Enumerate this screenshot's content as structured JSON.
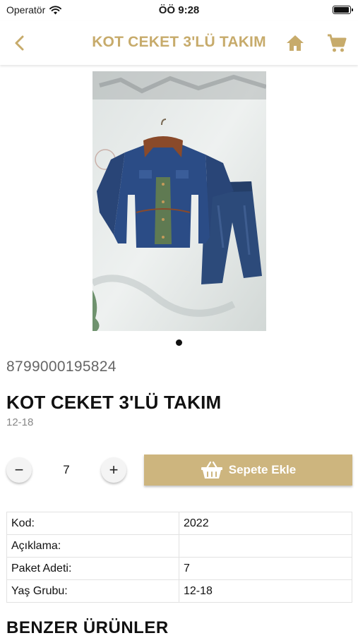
{
  "status_bar": {
    "carrier": "Operatör",
    "time": "ÖÖ 9:28",
    "battery_level": 0.95
  },
  "nav": {
    "title": "KOT CEKET 3'LÜ TAKIM",
    "back_icon": "chevron-left-icon",
    "home_icon": "home-icon",
    "cart_icon": "cart-icon",
    "accent_color": "#c7ab6b"
  },
  "product": {
    "barcode": "8799000195824",
    "title": "KOT CEKET 3'LÜ TAKIM",
    "subtitle": "12-18",
    "image_pages": 1,
    "current_image": 1
  },
  "quantity": {
    "minus_label": "−",
    "plus_label": "+",
    "value": "7"
  },
  "cart_button": {
    "label": "Sepete Ekle",
    "icon": "basket-icon",
    "color": "#cdb57e"
  },
  "specs": [
    {
      "key": "Kod:",
      "value": "2022"
    },
    {
      "key": "Açıklama:",
      "value": ""
    },
    {
      "key": "Paket Adeti:",
      "value": "7"
    },
    {
      "key": "Yaş Grubu:",
      "value": "12-18"
    }
  ],
  "similar": {
    "heading": "BENZER ÜRÜNLER"
  }
}
